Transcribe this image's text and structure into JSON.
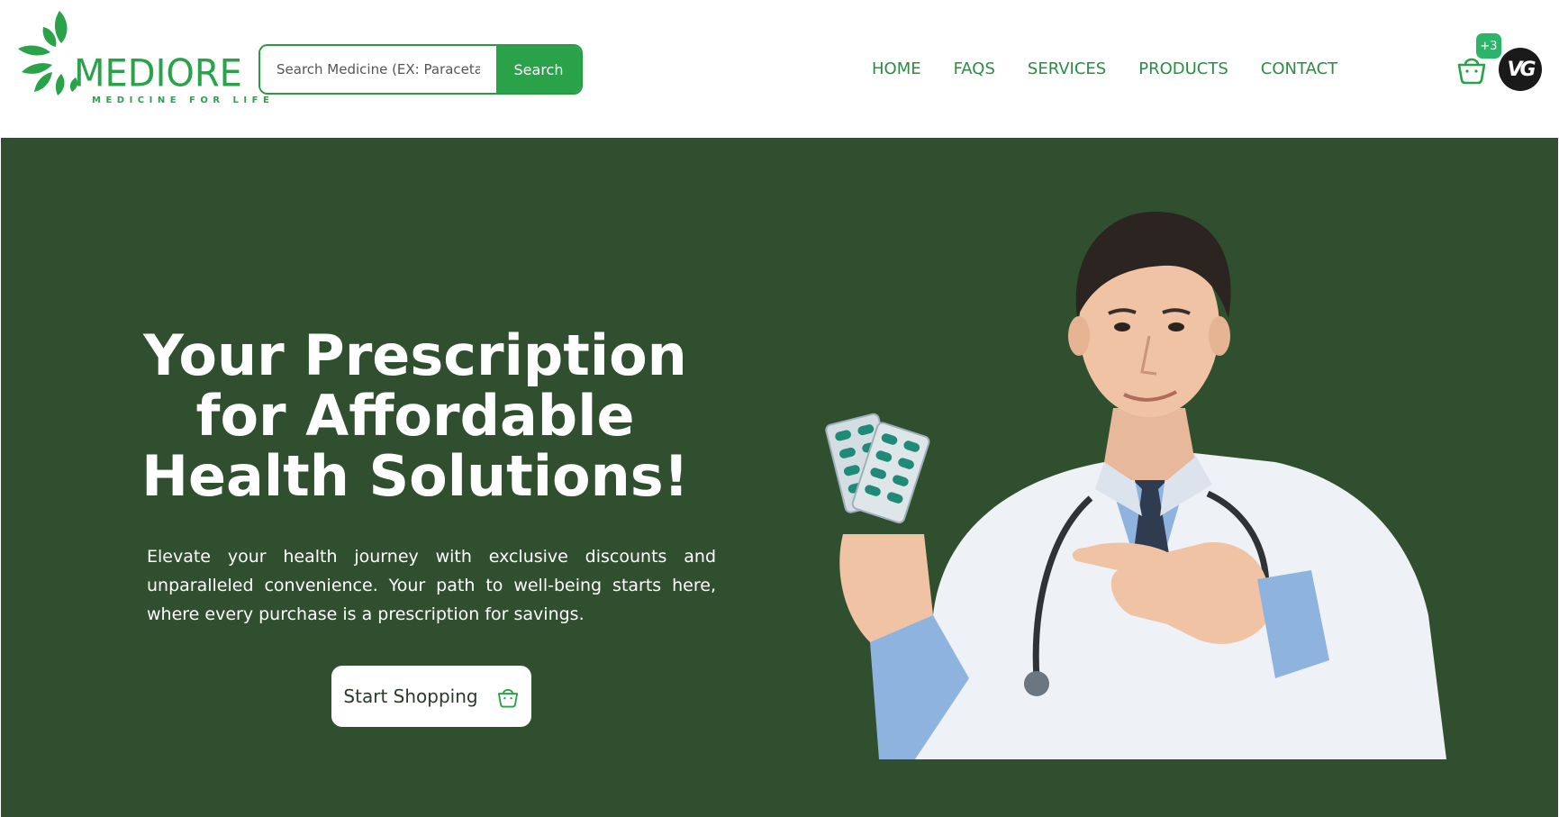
{
  "brand": {
    "name": "MEDIORE",
    "tagline": "MEDICINE FOR LIFE",
    "color": "#2aa24a"
  },
  "search": {
    "placeholder": "Search Medicine (EX: Paracetamol)",
    "button_label": "Search"
  },
  "nav": {
    "items": [
      {
        "label": "HOME"
      },
      {
        "label": "FAQS"
      },
      {
        "label": "SERVICES"
      },
      {
        "label": "PRODUCTS"
      },
      {
        "label": "CONTACT"
      }
    ]
  },
  "cart": {
    "badge": "+3",
    "icon": "shopping-basket-icon"
  },
  "user": {
    "avatar_initials": "VG"
  },
  "hero": {
    "title": "Your Prescription for Affordable Health Solutions!",
    "description": "Elevate your health journey with exclusive discounts and unparalleled convenience. Your path to well-being starts here, where every purchase is a prescription for savings.",
    "cta_label": "Start Shopping",
    "cta_icon": "shopping-basket-icon",
    "background_color": "#304f2f",
    "image": "doctor-holding-pills-photo"
  }
}
